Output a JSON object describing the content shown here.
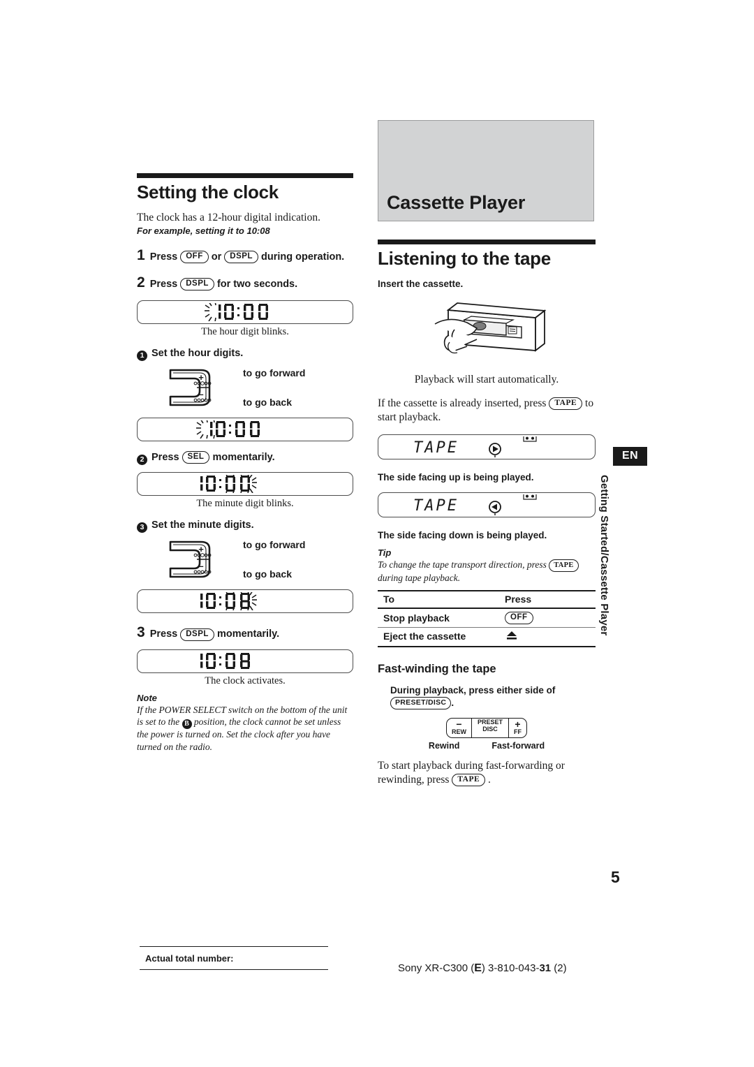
{
  "document": {
    "page_number": "5",
    "language_tab": "EN",
    "running_head": "Getting Started/Cassette Player"
  },
  "left_column": {
    "section_title": "Setting the clock",
    "intro": "The clock has a 12-hour digital indication.",
    "example_line": "For example, setting it to 10:08",
    "steps": [
      {
        "number": "1",
        "text_before": "Press",
        "button_a": "OFF",
        "text_mid": "or",
        "button_b": "DSPL",
        "text_after": "during operation."
      },
      {
        "number": "2",
        "text_before": "Press",
        "button_a": "DSPL",
        "text_after": "for two seconds."
      },
      {
        "number": "3",
        "text_before": "Press",
        "button_a": "DSPL",
        "text_after": "momentarily."
      }
    ],
    "display_1": {
      "value": "10:00",
      "blink": "hour",
      "caption": "The hour digit blinks."
    },
    "display_2": {
      "value": "10:00",
      "blink": "hour",
      "caption": ""
    },
    "display_3": {
      "value": "10:00",
      "blink": "minute",
      "caption": "The minute digit blinks."
    },
    "display_4": {
      "value": "10:08",
      "blink": "minute",
      "caption": ""
    },
    "display_5": {
      "value": "10:08",
      "blink": "none",
      "caption": "The clock activates."
    },
    "substeps": [
      {
        "marker": "1",
        "text": "Set the hour digits."
      },
      {
        "marker": "2",
        "text_before": "Press",
        "button": "SEL",
        "text_after": "momentarily."
      },
      {
        "marker": "3",
        "text": "Set the minute digits."
      }
    ],
    "rocker": {
      "plus": "+",
      "minus": "−",
      "forward_label": "to go forward",
      "back_label": "to go back"
    },
    "note": {
      "heading": "Note",
      "body_part1": "If the POWER SELECT switch on the bottom of the unit is set to the",
      "inline_marker": "B",
      "body_part2": "position, the clock cannot be set unless the power is turned on. Set the clock after you have turned on the radio."
    }
  },
  "right_column": {
    "chapter_title": "Cassette Player",
    "section_title": "Listening to the tape",
    "insert_heading": "Insert the cassette.",
    "auto_play_text": "Playback will start automatically.",
    "already_inserted": {
      "text_before": "If the cassette is already inserted, press",
      "button": "TAPE",
      "text_after": "to start playback."
    },
    "tape_display_up": {
      "label": "TAPE",
      "direction": "forward",
      "caption": "The side facing up is being played."
    },
    "tape_display_down": {
      "label": "TAPE",
      "direction": "reverse",
      "caption": "The side facing down is being played."
    },
    "tip": {
      "heading": "Tip",
      "text_before": "To change the tape transport direction, press",
      "button": "TAPE",
      "text_after": "during tape playback."
    },
    "table": {
      "headers": [
        "To",
        "Press"
      ],
      "rows": [
        {
          "action": "Stop playback",
          "press_type": "pill",
          "press": "OFF"
        },
        {
          "action": "Eject the cassette",
          "press_type": "icon",
          "press": "eject-icon"
        }
      ]
    },
    "fastwind": {
      "title": "Fast-winding the tape",
      "instruction_before": "During playback, press either side of",
      "button": "PRESET/DISC",
      "instruction_after": ".",
      "rocker": {
        "left_sign": "−",
        "left_label": "REW",
        "mid_line1": "PRESET",
        "mid_line2": "DISC",
        "right_sign": "+",
        "right_label": "FF"
      },
      "labels": {
        "rewind": "Rewind",
        "fast_forward": "Fast-forward"
      },
      "resume_before": "To start playback  during fast-forwarding or rewinding, press",
      "resume_button": "TAPE",
      "resume_after": "."
    }
  },
  "footer": {
    "left_label": "Actual total number:",
    "brand": "Sony XR-C300 (",
    "region_mark": "E",
    "model_mid": ") 3-810-043-",
    "model_bold": "31",
    "revision": "(2)"
  }
}
